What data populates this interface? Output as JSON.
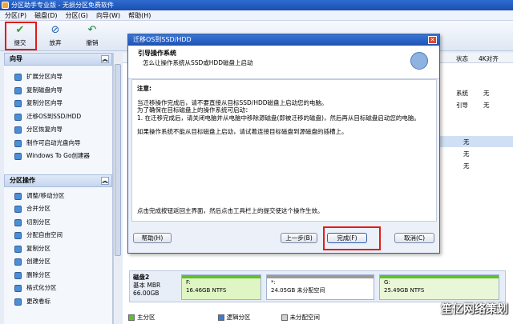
{
  "window": {
    "title": "分区助手专业版 - 无损分区免费软件"
  },
  "menu": [
    "分区(P)",
    "磁盘(D)",
    "分区(G)",
    "向导(W)",
    "帮助(H)"
  ],
  "toolbar": {
    "commit": "提交",
    "discard": "放弃",
    "undo": "撤销"
  },
  "wizard": {
    "title": "向导",
    "items": [
      "扩展分区向导",
      "复制磁盘向导",
      "复制分区向导",
      "迁移OS到SSD/HDD",
      "分区恢复向导",
      "制作可启动光盘向导",
      "Windows To Go创建器"
    ]
  },
  "partops": {
    "title": "分区操作",
    "items": [
      "调整/移动分区",
      "合并分区",
      "切割分区",
      "分配自由空间",
      "复制分区",
      "创建分区",
      "删除分区",
      "格式化分区",
      "更改卷标"
    ]
  },
  "table": {
    "col_status": "状态",
    "col_extra": "4K对齐",
    "rows": [
      [
        "系统",
        "无"
      ],
      [
        "引导",
        "无"
      ],
      [
        "",
        "无"
      ],
      [
        "",
        "无"
      ],
      [
        "",
        "无"
      ]
    ]
  },
  "disk2": {
    "name": "磁盘2",
    "type": "基本 MBR",
    "size": "66.00GB",
    "parts": [
      {
        "label": "F:",
        "info": "16.46GB NTFS"
      },
      {
        "label": "*:",
        "info": "24.05GB 未分配空间"
      },
      {
        "label": "G:",
        "info": "25.49GB NTFS"
      }
    ]
  },
  "legend": [
    "主分区",
    "逻辑分区",
    "未分配空间"
  ],
  "dialog": {
    "title": "迁移OS到SSD/HDD",
    "heading": "引导操作系统",
    "subheading": "怎么让操作系统从SSD或HDD磁盘上启动",
    "note_title": "注意:",
    "lines": [
      "当迁移操作完成后，请不要直接从目标SSD/HDD磁盘上启动您的电脑。",
      "为了确保在目标磁盘上的操作系统可启动：",
      "1. 在迁移完成后，请关闭电脑并从电脑中移除源磁盘(即被迁移的磁盘)，然后再从目标磁盘启动您的电脑。"
    ],
    "line2": "如果操作系统不能从目标磁盘上启动，请试着连接目标磁盘到源磁盘的插槽上。",
    "footer": "点击完成按钮返回主界面，然后点击工具栏上的提交使这个操作生效。",
    "btn_help": "帮助(H)",
    "btn_back": "上一步(B)",
    "btn_finish": "完成(F)",
    "btn_cancel": "取消(C)"
  },
  "watermark": "笙亿网络策划"
}
